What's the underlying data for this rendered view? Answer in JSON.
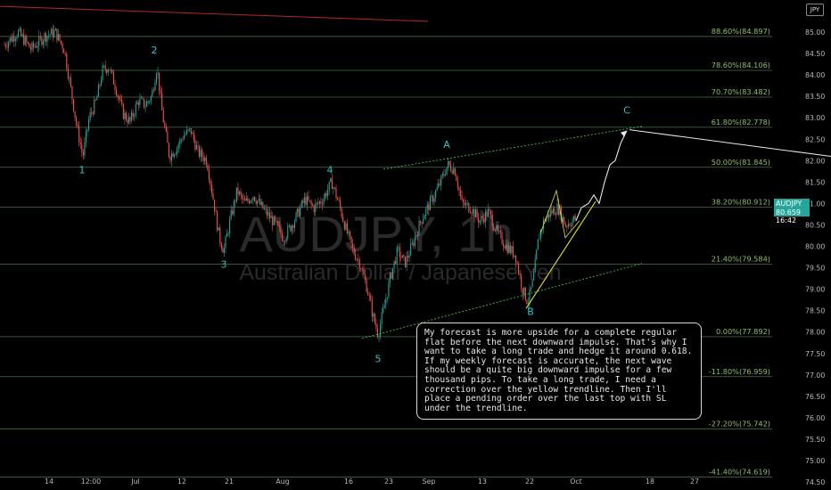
{
  "watermark": {
    "symbol": "AUDJPY, 1h",
    "name": "Australian Dollar / Japanese Yen"
  },
  "symbol_tag": "AUDJPY",
  "current_price": "80.659",
  "countdown": "16:42",
  "currency_tag": "JPY",
  "note": "My forecast is more upside for a complete regular flat before the next downward impulse. That's why I want to take a long trade and hedge it around 0.618. If my weekly forecast is accurate, the next wave should be a quite big downward impulse for a few thousand pips. To take a long trade, I need a correction over the yellow trendline. Then I'll place a pending order over the last top with SL under the trendline.",
  "colors": {
    "background": "#000000",
    "fib_line": "#4d6b4d",
    "fib_label": "#8fbf6a",
    "wave_label": "#2ec4c8",
    "bull": "#26a69a",
    "bear": "#ef5350",
    "channel": "#3fbf3f",
    "trendline": "#e6e62e",
    "projection": "#e8e8e8",
    "red_line": "#b02a2a"
  },
  "chart_data": {
    "type": "candlestick",
    "symbol": "AUDJPY",
    "timeframe": "1h",
    "ylim": [
      73.7,
      85.6
    ],
    "y_ticks": [
      74.0,
      74.5,
      75.0,
      75.5,
      76.0,
      76.5,
      77.0,
      77.5,
      78.0,
      78.5,
      79.0,
      79.5,
      80.0,
      80.5,
      81.0,
      81.5,
      82.0,
      82.5,
      83.0,
      83.5,
      84.0,
      84.5,
      85.0
    ],
    "x_ticks": [
      {
        "label": "14",
        "x": 55
      },
      {
        "label": "12:00",
        "x": 102
      },
      {
        "label": "Jul",
        "x": 152
      },
      {
        "label": "12",
        "x": 204
      },
      {
        "label": "21",
        "x": 257
      },
      {
        "label": "Aug",
        "x": 317
      },
      {
        "label": "16",
        "x": 391
      },
      {
        "label": "23",
        "x": 436
      },
      {
        "label": "Sep",
        "x": 481
      },
      {
        "label": "13",
        "x": 541
      },
      {
        "label": "22",
        "x": 594
      },
      {
        "label": "Oct",
        "x": 646
      },
      {
        "label": "18",
        "x": 729
      },
      {
        "label": "27",
        "x": 779
      }
    ],
    "fib_levels": [
      {
        "label": "88.60%(84.897)",
        "value": 84.897
      },
      {
        "label": "78.60%(84.106)",
        "value": 84.106
      },
      {
        "label": "70.70%(83.482)",
        "value": 83.482
      },
      {
        "label": "61.80%(82.778)",
        "value": 82.778
      },
      {
        "label": "50.00%(81.845)",
        "value": 81.845
      },
      {
        "label": "38.20%(80.912)",
        "value": 80.912
      },
      {
        "label": "21.40%(79.584)",
        "value": 79.584
      },
      {
        "label": "0.00%(77.892)",
        "value": 77.892
      },
      {
        "label": "-11.80%(76.959)",
        "value": 76.959
      },
      {
        "label": "-27.20%(75.742)",
        "value": 75.742
      },
      {
        "label": "-41.40%(74.619)",
        "value": 74.619
      }
    ],
    "wave_labels": [
      {
        "label": "1",
        "x": 92,
        "value": 81.7
      },
      {
        "label": "2",
        "x": 173,
        "value": 84.5
      },
      {
        "label": "3",
        "x": 251,
        "value": 79.5
      },
      {
        "label": "4",
        "x": 370,
        "value": 81.7
      },
      {
        "label": "5",
        "x": 424,
        "value": 77.3
      },
      {
        "label": "A",
        "x": 501,
        "value": 82.3
      },
      {
        "label": "B",
        "x": 595,
        "value": 78.4
      },
      {
        "label": "C",
        "x": 703,
        "value": 83.1
      }
    ],
    "price_path": [
      {
        "x": 5,
        "value": 84.7
      },
      {
        "x": 20,
        "value": 85.0
      },
      {
        "x": 35,
        "value": 84.6
      },
      {
        "x": 50,
        "value": 84.9
      },
      {
        "x": 62,
        "value": 85.0
      },
      {
        "x": 72,
        "value": 84.6
      },
      {
        "x": 80,
        "value": 83.6
      },
      {
        "x": 86,
        "value": 82.8
      },
      {
        "x": 93,
        "value": 82.1
      },
      {
        "x": 100,
        "value": 83.0
      },
      {
        "x": 108,
        "value": 83.4
      },
      {
        "x": 115,
        "value": 84.1
      },
      {
        "x": 122,
        "value": 84.2
      },
      {
        "x": 130,
        "value": 83.7
      },
      {
        "x": 138,
        "value": 83.1
      },
      {
        "x": 146,
        "value": 82.9
      },
      {
        "x": 155,
        "value": 83.4
      },
      {
        "x": 163,
        "value": 83.3
      },
      {
        "x": 170,
        "value": 83.5
      },
      {
        "x": 176,
        "value": 84.2
      },
      {
        "x": 182,
        "value": 83.1
      },
      {
        "x": 190,
        "value": 82.1
      },
      {
        "x": 198,
        "value": 82.3
      },
      {
        "x": 206,
        "value": 82.6
      },
      {
        "x": 214,
        "value": 82.7
      },
      {
        "x": 222,
        "value": 82.2
      },
      {
        "x": 232,
        "value": 82.0
      },
      {
        "x": 240,
        "value": 81.0
      },
      {
        "x": 246,
        "value": 80.2
      },
      {
        "x": 251,
        "value": 79.9
      },
      {
        "x": 258,
        "value": 80.6
      },
      {
        "x": 266,
        "value": 81.3
      },
      {
        "x": 274,
        "value": 81.0
      },
      {
        "x": 284,
        "value": 81.2
      },
      {
        "x": 294,
        "value": 80.9
      },
      {
        "x": 306,
        "value": 80.6
      },
      {
        "x": 318,
        "value": 80.2
      },
      {
        "x": 330,
        "value": 80.6
      },
      {
        "x": 342,
        "value": 81.1
      },
      {
        "x": 352,
        "value": 80.9
      },
      {
        "x": 362,
        "value": 81.1
      },
      {
        "x": 372,
        "value": 81.5
      },
      {
        "x": 380,
        "value": 81.0
      },
      {
        "x": 388,
        "value": 80.4
      },
      {
        "x": 396,
        "value": 79.9
      },
      {
        "x": 404,
        "value": 79.6
      },
      {
        "x": 412,
        "value": 79.0
      },
      {
        "x": 418,
        "value": 78.4
      },
      {
        "x": 424,
        "value": 77.95
      },
      {
        "x": 430,
        "value": 78.5
      },
      {
        "x": 438,
        "value": 79.3
      },
      {
        "x": 446,
        "value": 79.9
      },
      {
        "x": 454,
        "value": 79.6
      },
      {
        "x": 462,
        "value": 80.0
      },
      {
        "x": 472,
        "value": 80.6
      },
      {
        "x": 482,
        "value": 81.0
      },
      {
        "x": 492,
        "value": 81.4
      },
      {
        "x": 502,
        "value": 81.9
      },
      {
        "x": 510,
        "value": 81.8
      },
      {
        "x": 518,
        "value": 81.0
      },
      {
        "x": 528,
        "value": 80.9
      },
      {
        "x": 538,
        "value": 80.6
      },
      {
        "x": 548,
        "value": 80.8
      },
      {
        "x": 558,
        "value": 80.3
      },
      {
        "x": 568,
        "value": 80.0
      },
      {
        "x": 578,
        "value": 79.8
      },
      {
        "x": 586,
        "value": 79.0
      },
      {
        "x": 592,
        "value": 78.7
      },
      {
        "x": 598,
        "value": 79.2
      },
      {
        "x": 604,
        "value": 80.2
      },
      {
        "x": 610,
        "value": 80.6
      },
      {
        "x": 618,
        "value": 80.8
      },
      {
        "x": 626,
        "value": 80.9
      },
      {
        "x": 634,
        "value": 80.5
      },
      {
        "x": 642,
        "value": 80.6
      },
      {
        "x": 646,
        "value": 80.659
      }
    ],
    "projection_path": [
      {
        "x": 646,
        "value": 80.6
      },
      {
        "x": 652,
        "value": 80.9
      },
      {
        "x": 660,
        "value": 81.0
      },
      {
        "x": 666,
        "value": 81.2
      },
      {
        "x": 672,
        "value": 81.0
      },
      {
        "x": 678,
        "value": 81.5
      },
      {
        "x": 684,
        "value": 81.9
      },
      {
        "x": 690,
        "value": 82.0
      },
      {
        "x": 696,
        "value": 82.4
      },
      {
        "x": 703,
        "value": 82.7
      }
    ],
    "target_line": [
      {
        "x": 706,
        "value": 82.72
      },
      {
        "x": 932,
        "value": 82.1
      }
    ],
    "channel_upper": [
      {
        "x": 430,
        "value": 81.8
      },
      {
        "x": 720,
        "value": 82.8
      }
    ],
    "channel_lower": [
      {
        "x": 406,
        "value": 77.85
      },
      {
        "x": 720,
        "value": 79.6
      }
    ],
    "yellow_trendline": [
      {
        "x": 590,
        "value": 78.55
      },
      {
        "x": 668,
        "value": 81.05
      }
    ],
    "small_wedge": [
      {
        "x": 606,
        "value": 80.3
      },
      {
        "x": 624,
        "value": 81.3
      },
      {
        "x": 634,
        "value": 80.2
      },
      {
        "x": 650,
        "value": 80.6
      }
    ],
    "red_line": [
      {
        "x": 0,
        "value": 85.6
      },
      {
        "x": 480,
        "value": 85.25
      }
    ]
  }
}
